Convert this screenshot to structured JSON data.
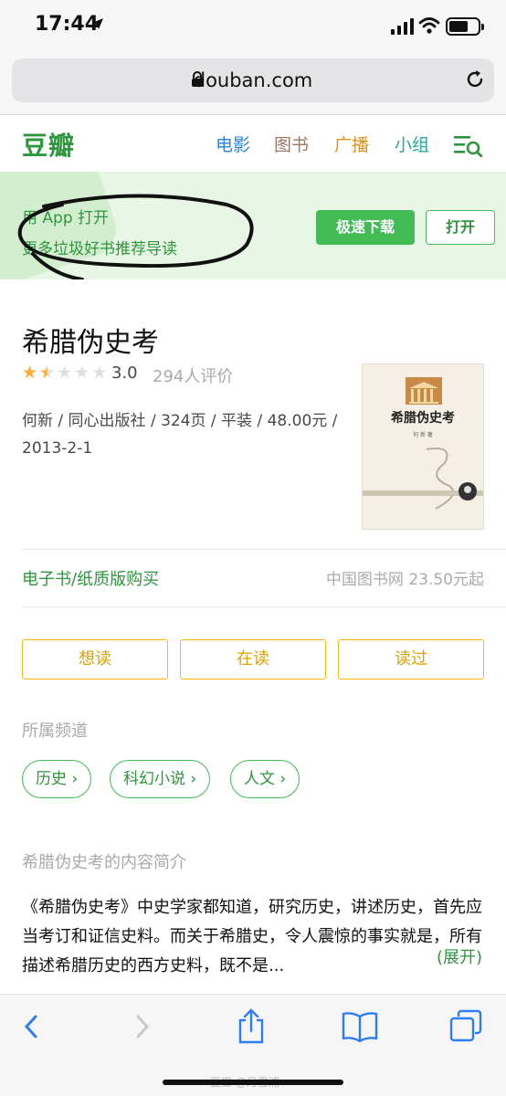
{
  "status_bar": {
    "time": "17:44"
  },
  "browser": {
    "url": "douban.com"
  },
  "header": {
    "logo": "豆瓣",
    "nav": [
      "电影",
      "图书",
      "广播",
      "小组"
    ]
  },
  "banner": {
    "line1": "用 App 打开",
    "line2": "更多垃圾好书推荐导读",
    "download_label": "极速下载",
    "open_label": "打开"
  },
  "book": {
    "title": "希腊伪史考",
    "rating": 3.0,
    "rating_text": "3.0",
    "stars_filled_fraction": 0.3,
    "ratings_count": "294人评价",
    "meta": "何新 / 同心出版社 / 324页 / 平装 / 48.00元 / 2013-2-1",
    "cover_title": "希腊伪史考",
    "cover_author": "何 新 著"
  },
  "purchase": {
    "link_label": "电子书/纸质版购买",
    "price_text": "中国图书网 23.50元起"
  },
  "mark_buttons": [
    "想读",
    "在读",
    "读过"
  ],
  "channels": {
    "label": "所属频道",
    "tags": [
      "历史 ›",
      "科幻小说 ›",
      "人文 ›"
    ]
  },
  "intro": {
    "label": "希腊伪史考的内容简介",
    "text": "《希腊伪史考》中史学家都知道，研究历史，讲述历史，首先应当考订和证信史料。而关于希腊史，令人震惊的事实就是，所有描述希腊历史的西方史料，既不是...",
    "more_label": "(展开)"
  },
  "watermark": "豆瓣 @月雪浦",
  "colors": {
    "douban_green": "#42bd56",
    "mark_yellow": "#ffb712"
  }
}
